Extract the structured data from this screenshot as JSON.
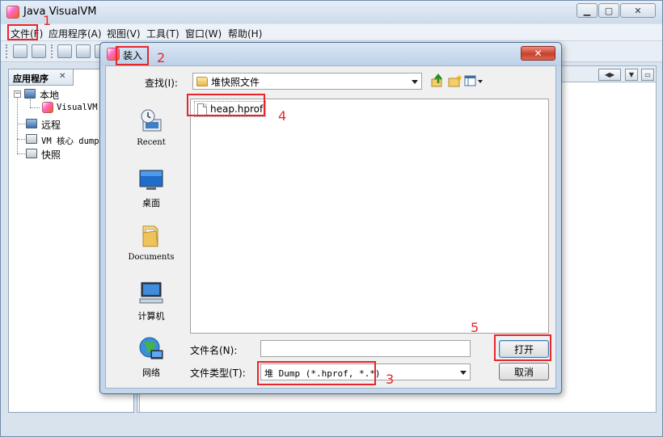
{
  "main_window": {
    "title": "Java VisualVM",
    "menus": [
      {
        "label": "文件(F)"
      },
      {
        "label": "应用程序(A)"
      },
      {
        "label": "视图(V)"
      },
      {
        "label": "工具(T)"
      },
      {
        "label": "窗口(W)"
      },
      {
        "label": "帮助(H)"
      }
    ],
    "apps_panel": {
      "tab_label": "应用程序",
      "tab_close": "✕",
      "tree": [
        {
          "label": "本地"
        },
        {
          "label": "VisualVM"
        },
        {
          "label": "远程"
        },
        {
          "label": "VM 核心 dump"
        },
        {
          "label": "快照"
        }
      ]
    }
  },
  "dialog": {
    "title": "装入",
    "close_symbol": "✕",
    "look_in_label": "查找(I):",
    "look_in_value": "堆快照文件",
    "places": [
      {
        "label": "Recent"
      },
      {
        "label": "桌面"
      },
      {
        "label": "Documents"
      },
      {
        "label": "计算机"
      },
      {
        "label": "网络"
      }
    ],
    "files": [
      {
        "name": "heap.hprof"
      }
    ],
    "filename_label": "文件名(N):",
    "filename_value": "",
    "filetype_label": "文件类型(T):",
    "filetype_value": "堆 Dump (*.hprof, *.*)",
    "open_label": "打开",
    "cancel_label": "取消"
  },
  "annotations": {
    "n1": "1",
    "n2": "2",
    "n3": "3",
    "n4": "4",
    "n5": "5"
  },
  "colors": {
    "highlight": "#e8262a",
    "close_button": "#c8402b"
  }
}
